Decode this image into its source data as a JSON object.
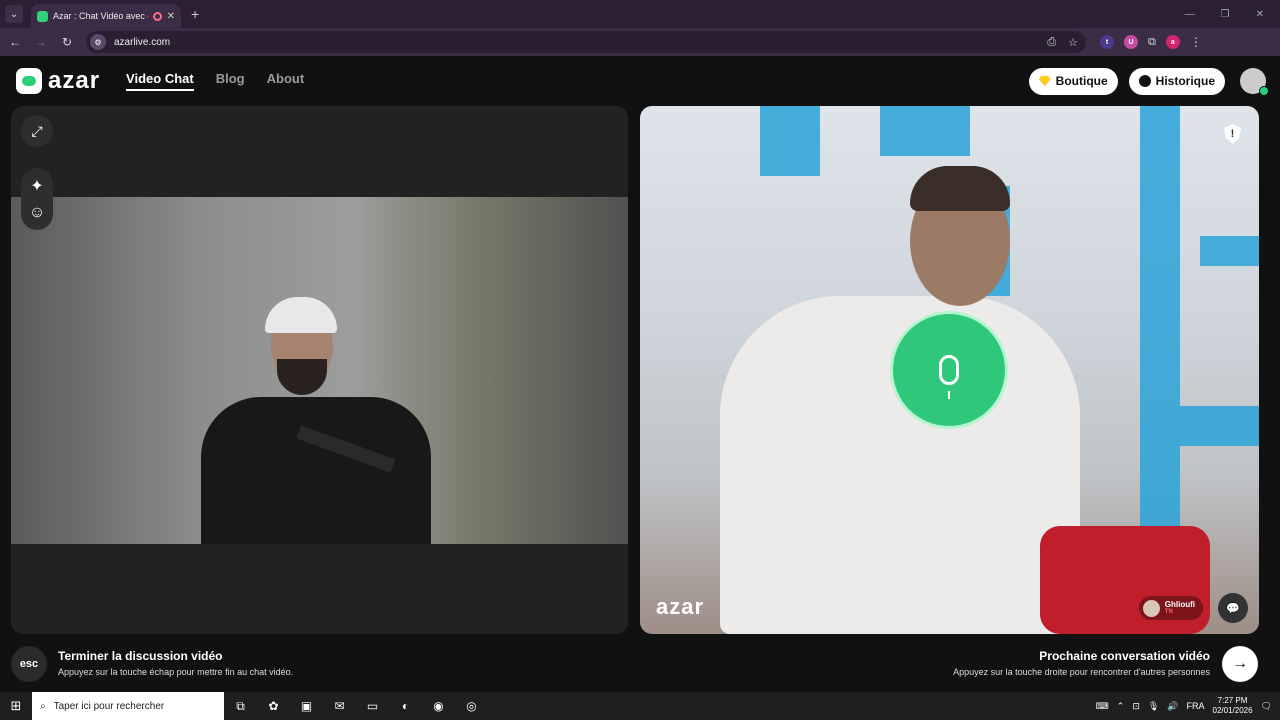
{
  "browser": {
    "tab_title": "Azar : Chat Vidéo avec de n",
    "url": "azarlive.com",
    "extensions": [
      "t",
      "U",
      "a"
    ],
    "accent": "#33d17a"
  },
  "site": {
    "logo_text": "azar",
    "nav": [
      "Video Chat",
      "Blog",
      "About"
    ],
    "boutique_label": "Boutique",
    "historique_label": "Historique"
  },
  "right_panel": {
    "watermark": "azar",
    "watermark_id": "LfVASsgQPB",
    "peer_name": "Ghlioufi",
    "peer_country": "TN",
    "mic_color": "#2fc779"
  },
  "bottom": {
    "esc_label": "esc",
    "end_title": "Terminer la discussion vidéo",
    "end_hint": "Appuyez sur la touche échap pour mettre fin au chat vidéo.",
    "next_title": "Prochaine conversation vidéo",
    "next_hint": "Appuyez sur la touche droite pour rencontrer d'autres personnes"
  },
  "taskbar": {
    "search_placeholder": "Taper ici pour rechercher",
    "lang": "FRA",
    "time": "7:27 PM",
    "date": "02/01/2026"
  }
}
